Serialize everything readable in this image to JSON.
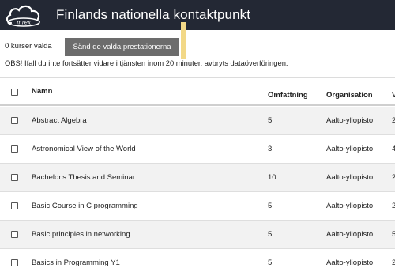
{
  "header": {
    "title": "Finlands nationella kontaktpunkt",
    "logo_text": "mrex",
    "background_color": "#232834"
  },
  "selection": {
    "count_text": "0 kurser valda",
    "send_button_label": "Sänd de valda prestationerna",
    "notice": "OBS! Ifall du inte fortsätter vidare i tjänsten inom 20 minuter, avbryts dataöverföringen."
  },
  "table": {
    "columns": [
      "Namn",
      "Omfattning",
      "Organisation",
      "V"
    ],
    "rows": [
      {
        "name": "Abstract Algebra",
        "scope": "5",
        "organisation": "Aalto-yliopisto",
        "extra": "2"
      },
      {
        "name": "Astronomical View of the World",
        "scope": "3",
        "organisation": "Aalto-yliopisto",
        "extra": "4"
      },
      {
        "name": "Bachelor's Thesis and Seminar",
        "scope": "10",
        "organisation": "Aalto-yliopisto",
        "extra": "2"
      },
      {
        "name": "Basic Course in C programming",
        "scope": "5",
        "organisation": "Aalto-yliopisto",
        "extra": "2"
      },
      {
        "name": "Basic principles in networking",
        "scope": "5",
        "organisation": "Aalto-yliopisto",
        "extra": "5"
      },
      {
        "name": "Basics in Programming Y1",
        "scope": "5",
        "organisation": "Aalto-yliopisto",
        "extra": "2"
      }
    ]
  }
}
